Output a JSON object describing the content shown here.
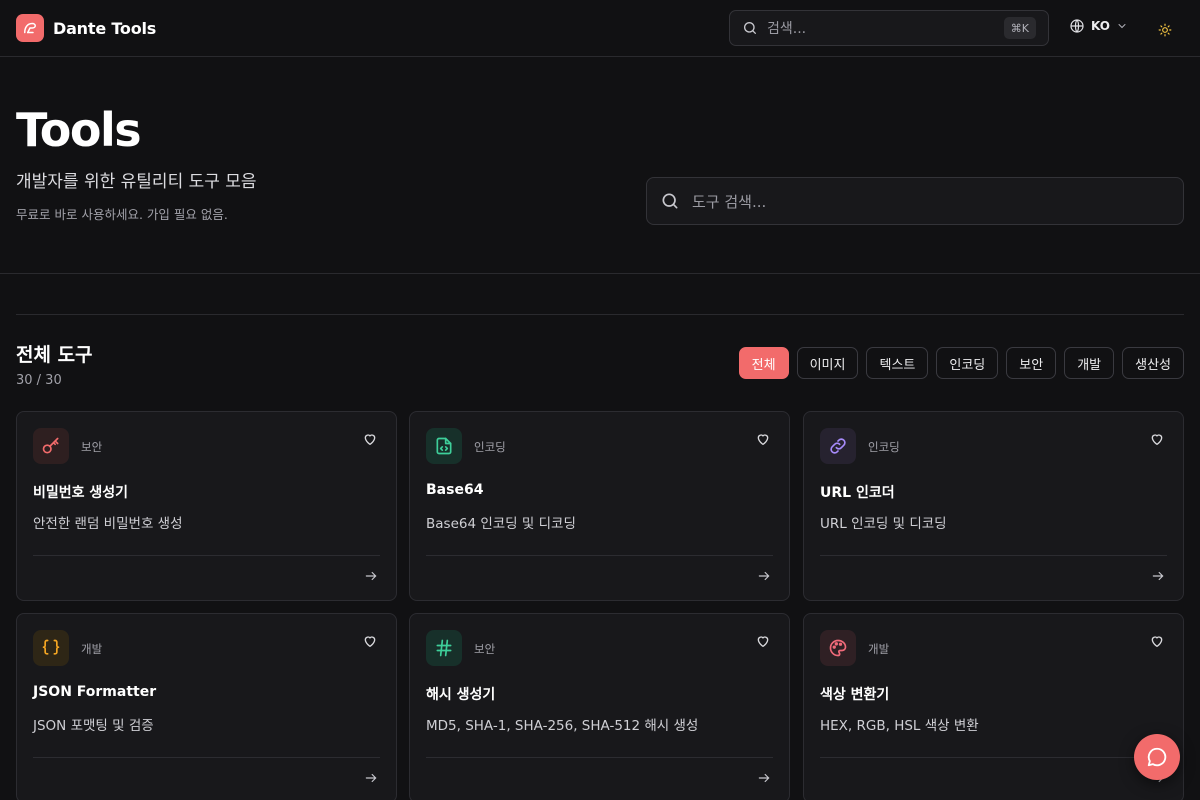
{
  "header": {
    "brand_name": "Dante Tools",
    "search_placeholder": "검색...",
    "search_shortcut": "⌘K",
    "language": "KO"
  },
  "hero": {
    "title": "Tools",
    "subtitle": "개발자를 위한 유틸리티 도구 모음",
    "note": "무료로 바로 사용하세요. 가입 필요 없음.",
    "search_placeholder": "도구 검색..."
  },
  "section": {
    "title": "전체 도구",
    "count": "30 / 30"
  },
  "filters": [
    {
      "label": "전체",
      "active": true
    },
    {
      "label": "이미지",
      "active": false
    },
    {
      "label": "텍스트",
      "active": false
    },
    {
      "label": "인코딩",
      "active": false
    },
    {
      "label": "보안",
      "active": false
    },
    {
      "label": "개발",
      "active": false
    },
    {
      "label": "생산성",
      "active": false
    }
  ],
  "tools": [
    {
      "category": "보안",
      "name": "비밀번호 생성기",
      "description": "안전한 랜덤 비밀번호 생성",
      "icon": "key-icon",
      "color": "#f26b6b"
    },
    {
      "category": "인코딩",
      "name": "Base64",
      "description": "Base64 인코딩 및 디코딩",
      "icon": "file-code-icon",
      "color": "#3ecf9a"
    },
    {
      "category": "인코딩",
      "name": "URL 인코더",
      "description": "URL 인코딩 및 디코딩",
      "icon": "link-icon",
      "color": "#a78bfa"
    },
    {
      "category": "개발",
      "name": "JSON Formatter",
      "description": "JSON 포맷팅 및 검증",
      "icon": "braces-icon",
      "color": "#f5a623"
    },
    {
      "category": "보안",
      "name": "해시 생성기",
      "description": "MD5, SHA-1, SHA-256, SHA-512 해시 생성",
      "icon": "hash-icon",
      "color": "#3ecf9a"
    },
    {
      "category": "개발",
      "name": "색상 변환기",
      "description": "HEX, RGB, HSL 색상 변환",
      "icon": "palette-icon",
      "color": "#f06a7a"
    }
  ],
  "colors": {
    "accent": "#f26b6b",
    "background": "#111113",
    "card": "#18181b"
  }
}
